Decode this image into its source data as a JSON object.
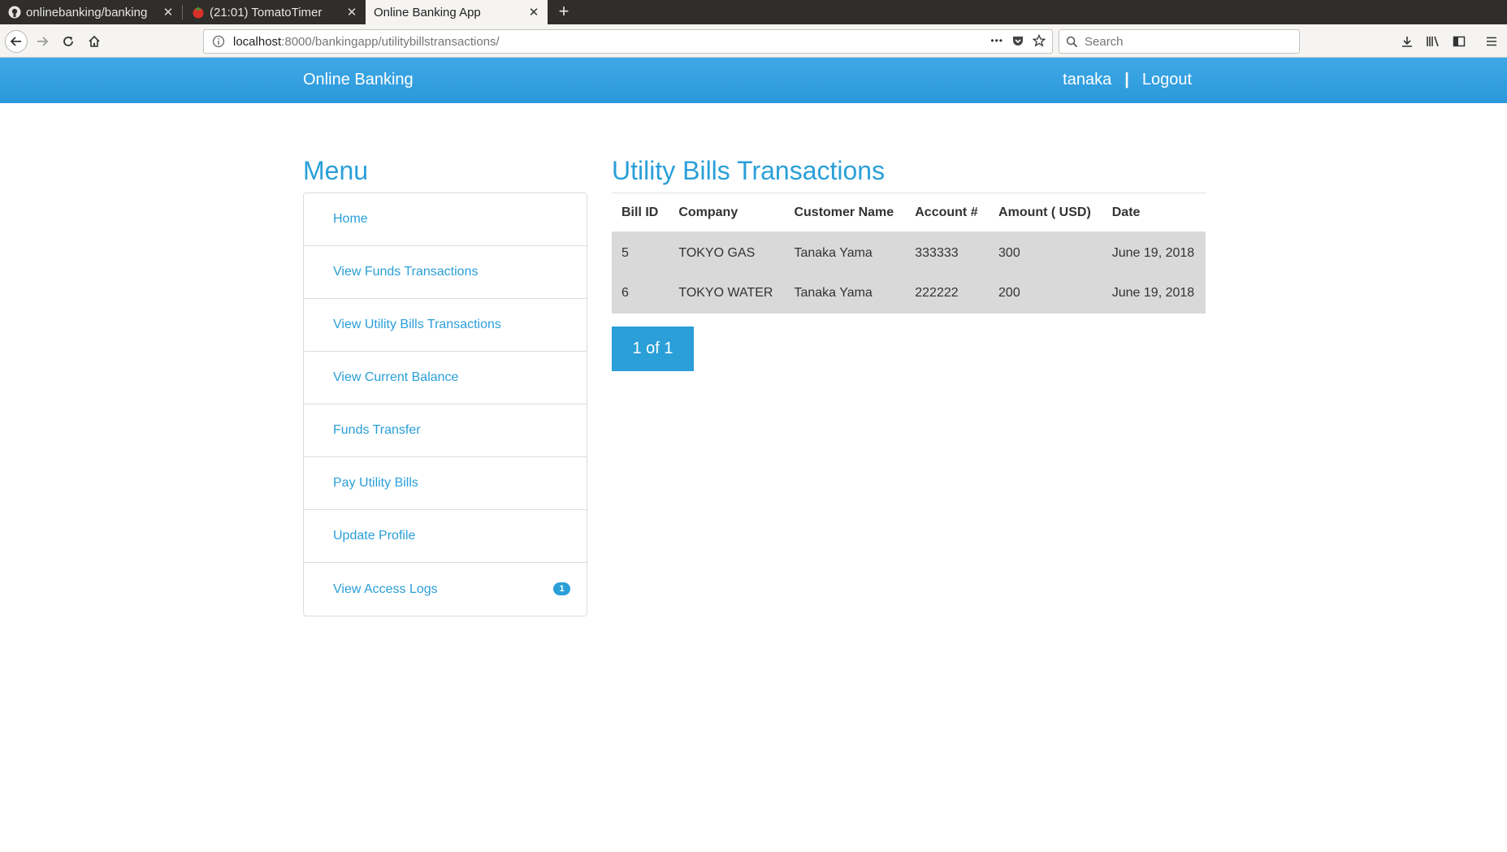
{
  "browser": {
    "tabs": [
      {
        "label": "onlinebanking/banking",
        "icon": "github-icon"
      },
      {
        "label": "(21:01) TomatoTimer",
        "icon": "tomato-icon"
      },
      {
        "label": "Online Banking App",
        "icon": ""
      }
    ],
    "close_glyph": "✕",
    "new_tab_glyph": "+",
    "url_host": "localhost",
    "url_rest": ":8000/bankingapp/utilitybillstransactions/",
    "url_more_glyph": "•••",
    "search_placeholder": "Search"
  },
  "header": {
    "brand": "Online Banking",
    "username": "tanaka",
    "separator": "|",
    "logout": "Logout",
    "color": "#2a98db"
  },
  "menu": {
    "title": "Menu",
    "items": [
      {
        "label": "Home"
      },
      {
        "label": "View Funds Transactions"
      },
      {
        "label": "View Utility Bills Transactions"
      },
      {
        "label": "View Current Balance"
      },
      {
        "label": "Funds Transfer"
      },
      {
        "label": "Pay Utility Bills"
      },
      {
        "label": "Update Profile"
      },
      {
        "label": "View Access Logs",
        "badge": "1"
      }
    ]
  },
  "main": {
    "title": "Utility Bills Transactions",
    "columns": [
      "Bill ID",
      "Company",
      "Customer Name",
      "Account #",
      "Amount ( USD)",
      "Date"
    ],
    "rows": [
      [
        "5",
        "TOKYO GAS",
        "Tanaka Yama",
        "333333",
        "300",
        "June 19, 2018"
      ],
      [
        "6",
        "TOKYO WATER",
        "Tanaka Yama",
        "222222",
        "200",
        "June 19, 2018"
      ]
    ],
    "pagination": "1 of 1"
  }
}
